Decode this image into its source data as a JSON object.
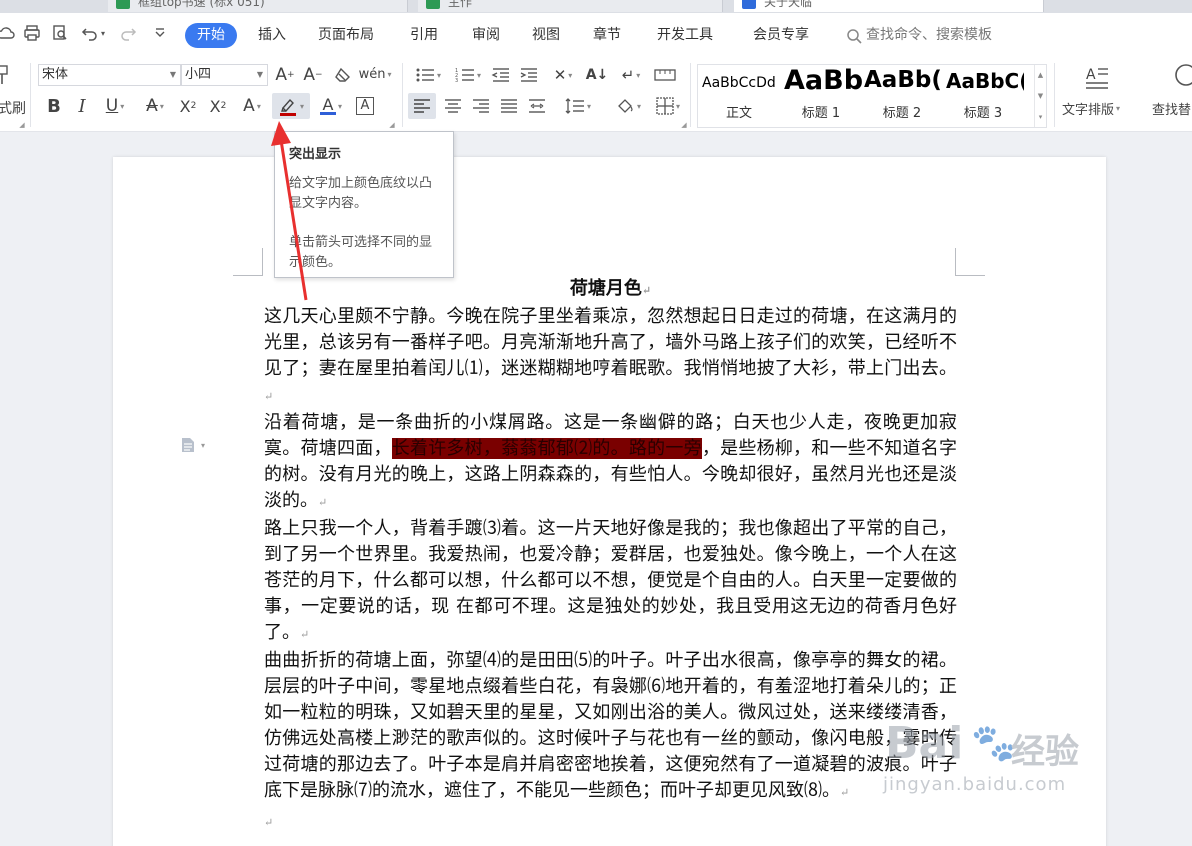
{
  "doc_tabs": [
    {
      "label": "框组top书速 (标x 051)"
    },
    {
      "label": "主作"
    },
    {
      "label": "关于天临"
    }
  ],
  "menu": {
    "tabs": [
      "开始",
      "插入",
      "页面布局",
      "引用",
      "审阅",
      "视图",
      "章节",
      "开发工具",
      "会员专享"
    ],
    "active": "开始",
    "search_placeholder": "查找命令、搜索模板"
  },
  "toolbar": {
    "format_painter_label": "式刷",
    "font_name": "宋体",
    "font_size": "小四",
    "styles": [
      {
        "sample": "AaBbCcDd",
        "caption": "正文"
      },
      {
        "sample": "AaBb",
        "caption": "标题 1"
      },
      {
        "sample": "AaBb(",
        "caption": "标题 2"
      },
      {
        "sample": "AaBbC(",
        "caption": "标题 3"
      }
    ],
    "text_layout_label": "文字排版",
    "find_replace_label": "查找替"
  },
  "tooltip": {
    "title": "突出显示",
    "line1": "给文字加上颜色底纹以凸显文字内容。",
    "line2": "单击箭头可选择不同的显示颜色。"
  },
  "colors": {
    "accent": "#3a7af0",
    "highlight_fill": "#7a0000",
    "arrow": "#e8302f",
    "font_color_bar": "#2f5fd8",
    "highlight_bar": "#c00000"
  },
  "document": {
    "title": "荷塘月色",
    "p1": "这几天心里颇不宁静。今晚在院子里坐着乘凉，忽然想起日日走过的荷塘，在这满月的光里，总该另有一番样子吧。月亮渐渐地升高了，墙外马路上孩子们的欢笑，已经听不见了；妻在屋里拍着闰儿⑴，迷迷糊糊地哼着眠歌。我悄悄地披了大衫，带上门出去。",
    "p2_before": "沿着荷塘，是一条曲折的小煤屑路。这是一条幽僻的路；白天也少人走，夜晚更加寂寞。荷塘四面，",
    "p2_highlight": "长着许多树，蓊蓊郁郁⑵的。路的一旁",
    "p2_after": "，是些杨柳，和一些不知道名字的树。没有月光的晚上，这路上阴森森的，有些怕人。今晚却很好，虽然月光也还是淡淡的。",
    "p3": "路上只我一个人，背着手踱⑶着。这一片天地好像是我的；我也像超出了平常的自己，到了另一个世界里。我爱热闹，也爱冷静；爱群居，也爱独处。像今晚上，一个人在这苍茫的月下，什么都可以想，什么都可以不想，便觉是个自由的人。白天里一定要做的事，一定要说的话，现 在都可不理。这是独处的妙处，我且受用这无边的荷香月色好了。",
    "p4": "曲曲折折的荷塘上面，弥望⑷的是田田⑸的叶子。叶子出水很高，像亭亭的舞女的裙。层层的叶子中间，零星地点缀着些白花，有袅娜⑹地开着的，有羞涩地打着朵儿的；正如一粒粒的明珠，又如碧天里的星星，又如刚出浴的美人。微风过处，送来缕缕清香，仿佛远处高楼上渺茫的歌声似的。这时候叶子与花也有一丝的颤动，像闪电般，霎时传过荷塘的那边去了。叶子本是肩并肩密密地挨着，这便宛然有了一道凝碧的波痕。叶子底下是脉脉⑺的流水，遮住了，不能见一些颜色；而叶子却更见风致⑻。"
  },
  "watermark": {
    "brand": "Bai",
    "brand_cn": "经验",
    "url": "jingyan.baidu.com"
  }
}
